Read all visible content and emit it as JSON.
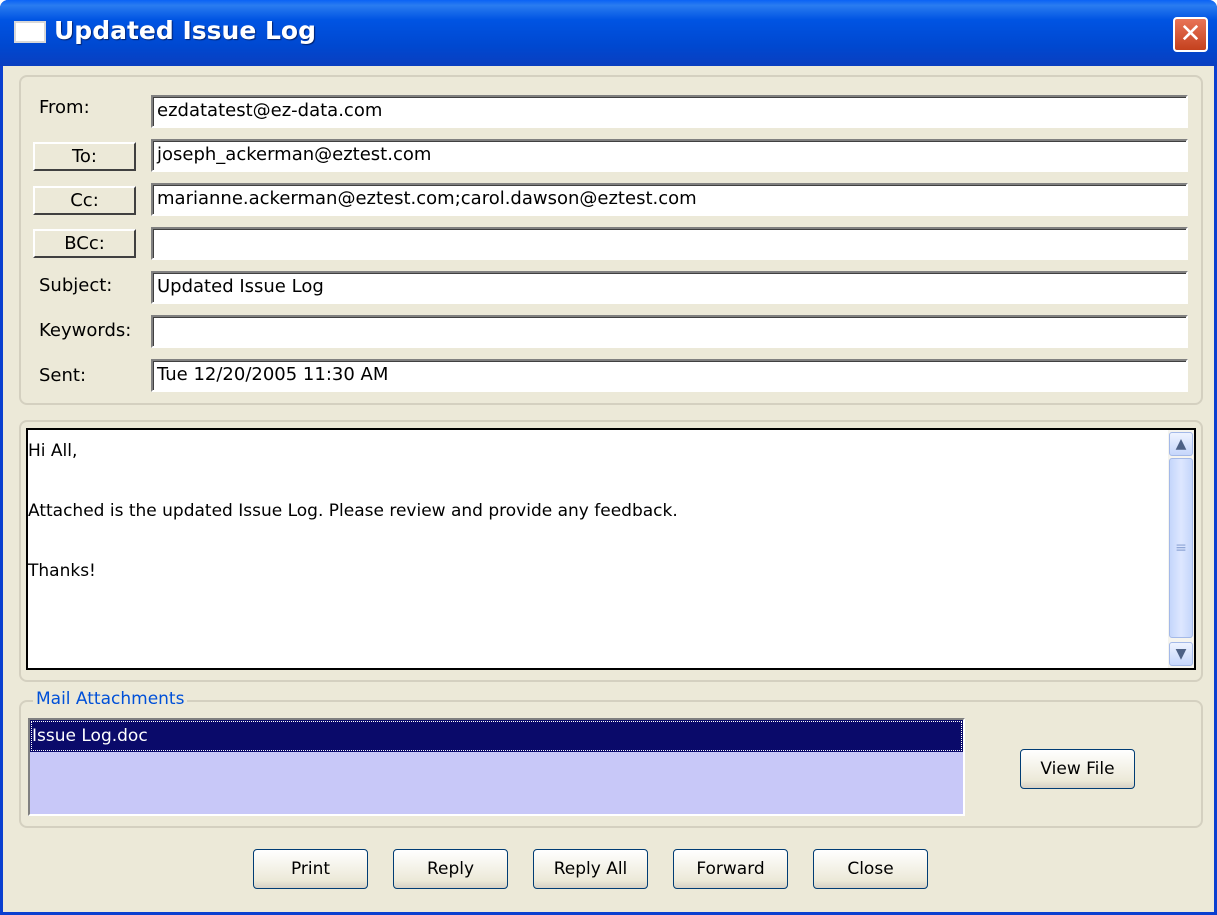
{
  "window": {
    "title": "Updated Issue Log",
    "close_glyph": "✕"
  },
  "header": {
    "from_label": "From:",
    "from_value": "ezdatatest@ez-data.com",
    "to_label": "To:",
    "to_value": "joseph_ackerman@eztest.com",
    "cc_label": "Cc:",
    "cc_value": "marianne.ackerman@eztest.com;carol.dawson@eztest.com",
    "bcc_label": "BCc:",
    "bcc_value": "",
    "subject_label": "Subject:",
    "subject_value": "Updated Issue Log",
    "keywords_label": "Keywords:",
    "keywords_value": "",
    "sent_label": "Sent:",
    "sent_value": "Tue  12/20/2005 11:30 AM"
  },
  "message": {
    "body": "Hi All,\n\nAttached is the updated Issue Log. Please review and provide any feedback.\n\nThanks!"
  },
  "scrollbar": {
    "up_icon": "▲",
    "down_icon": "▼",
    "grip_icon": "≡"
  },
  "attachments": {
    "legend": "Mail Attachments",
    "items": [
      "Issue Log.doc"
    ],
    "view_file_label": "View File"
  },
  "actions": {
    "print": "Print",
    "reply": "Reply",
    "reply_all": "Reply All",
    "forward": "Forward",
    "close": "Close"
  }
}
